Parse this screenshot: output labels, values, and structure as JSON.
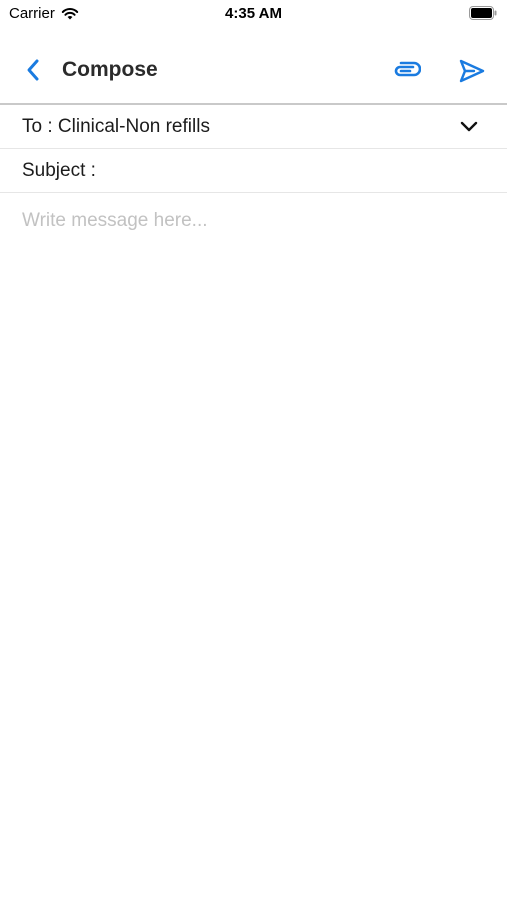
{
  "status_bar": {
    "carrier": "Carrier",
    "time": "4:35 AM"
  },
  "nav": {
    "title": "Compose",
    "back_icon": "chevron-left-icon",
    "attach_icon": "paperclip-icon",
    "send_icon": "send-icon"
  },
  "compose": {
    "to_label": "To : Clinical-Non refills",
    "subject_label": "Subject :",
    "message_placeholder": "Write message here..."
  },
  "colors": {
    "accent": "#1a7be0",
    "text": "#1c1c1c",
    "placeholder": "#c2c2c2",
    "divider": "#e6e6e6"
  }
}
